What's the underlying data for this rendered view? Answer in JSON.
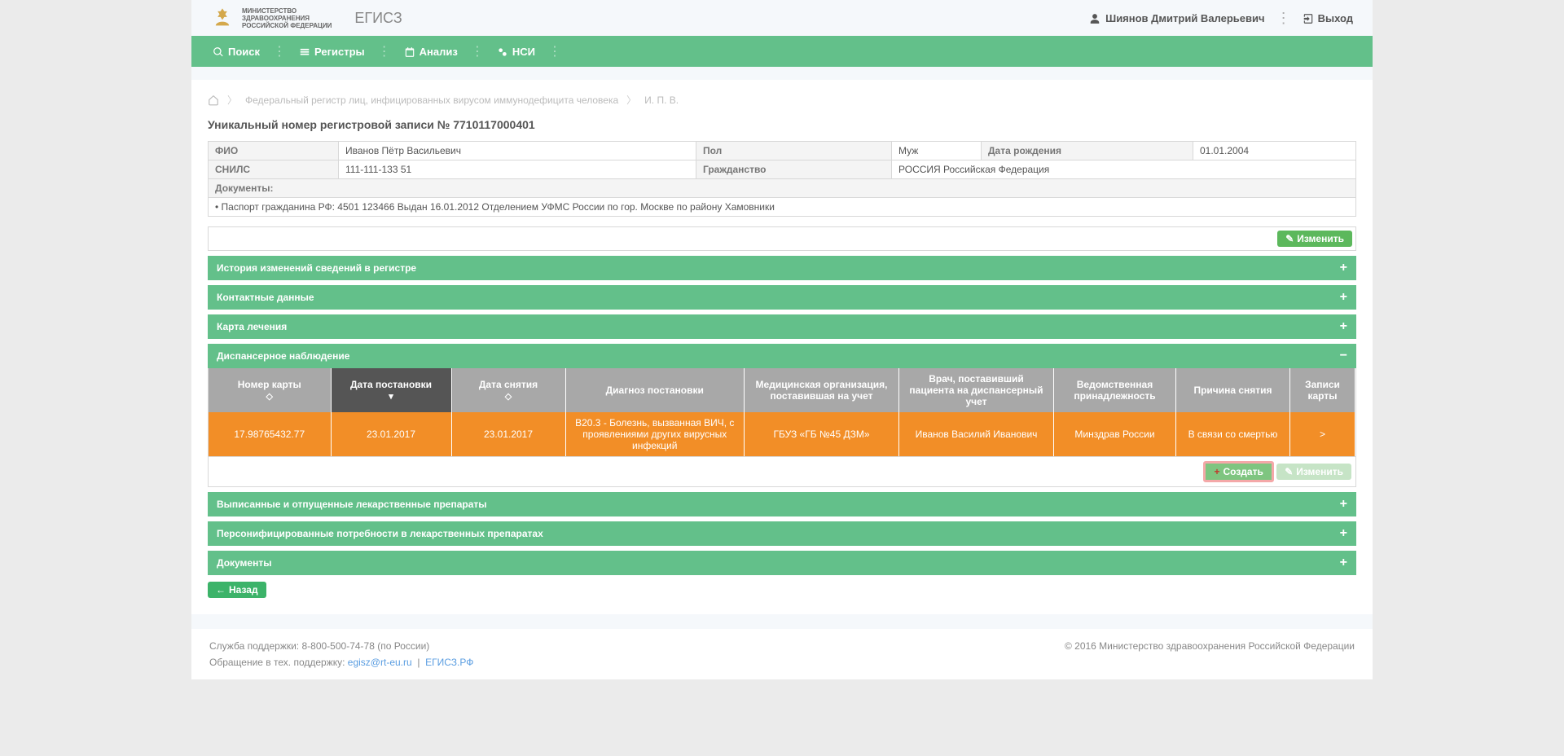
{
  "header": {
    "ministry_line1": "МИНИСТЕРСТВО",
    "ministry_line2": "ЗДРАВООХРАНЕНИЯ",
    "ministry_line3": "РОССИЙСКОЙ ФЕДЕРАЦИИ",
    "app_name": "ЕГИСЗ",
    "user_name": "Шиянов Дмитрий Валерьевич",
    "logout": "Выход"
  },
  "nav": {
    "search": "Поиск",
    "registers": "Регистры",
    "analysis": "Анализ",
    "nsi": "НСИ"
  },
  "breadcrumbs": {
    "level1": "Федеральный регистр лиц, инфицированных вирусом иммунодефицита человека",
    "level2": "И. П. В."
  },
  "page_title": "Уникальный номер регистровой записи № 7710117000401",
  "info": {
    "fio_label": "ФИО",
    "fio": "Иванов Пётр Васильевич",
    "gender_label": "Пол",
    "gender": "Муж",
    "dob_label": "Дата рождения",
    "dob": "01.01.2004",
    "snils_label": "СНИЛС",
    "snils": "111-111-133 51",
    "citizenship_label": "Гражданство",
    "citizenship": "РОССИЯ Российская Федерация",
    "documents_label": "Документы:",
    "document_line": "• Паспорт гражданина РФ: 4501 123466 Выдан 16.01.2012 Отделением УФМС России по гор. Москве по району Хамовники"
  },
  "buttons": {
    "edit": "Изменить",
    "create": "Создать",
    "back": "Назад"
  },
  "accordions": {
    "history": "История изменений сведений в регистре",
    "contacts": "Контактные данные",
    "treatment": "Карта лечения",
    "dispensary": "Диспансерное наблюдение",
    "prescriptions": "Выписанные и отпущенные лекарственные препараты",
    "needs": "Персонифицированные потребности в лекарственных препаратах",
    "documents": "Документы"
  },
  "dispensary_table": {
    "headers": {
      "card_no": "Номер карты",
      "date_set": "Дата постановки",
      "date_removed": "Дата снятия",
      "diagnosis": "Диагноз постановки",
      "med_org": "Медицинская организация, поставившая на учет",
      "doctor": "Врач, поставивший пациента на диспансерный учет",
      "department": "Ведомственная принадлежность",
      "reason": "Причина снятия",
      "card_records": "Записи карты"
    },
    "row": {
      "card_no": "17.98765432.77",
      "date_set": "23.01.2017",
      "date_removed": "23.01.2017",
      "diagnosis": "B20.3 - Болезнь, вызванная ВИЧ, с проявлениями других вирусных инфекций",
      "med_org": "ГБУЗ «ГБ №45 ДЗМ»",
      "doctor": "Иванов Василий Иванович",
      "department": "Минздрав России",
      "reason": "В связи со смертью",
      "card_records": ">"
    }
  },
  "footer": {
    "support_label": "Служба поддержки: ",
    "support_phone": "8-800-500-74-78 (по России)",
    "appeal_label": "Обращение в тех. поддержку: ",
    "email": "egisz@rt-eu.ru",
    "site": "ЕГИСЗ.РФ",
    "copyright": "© 2016 Министерство здравоохранения Российской Федерации"
  }
}
